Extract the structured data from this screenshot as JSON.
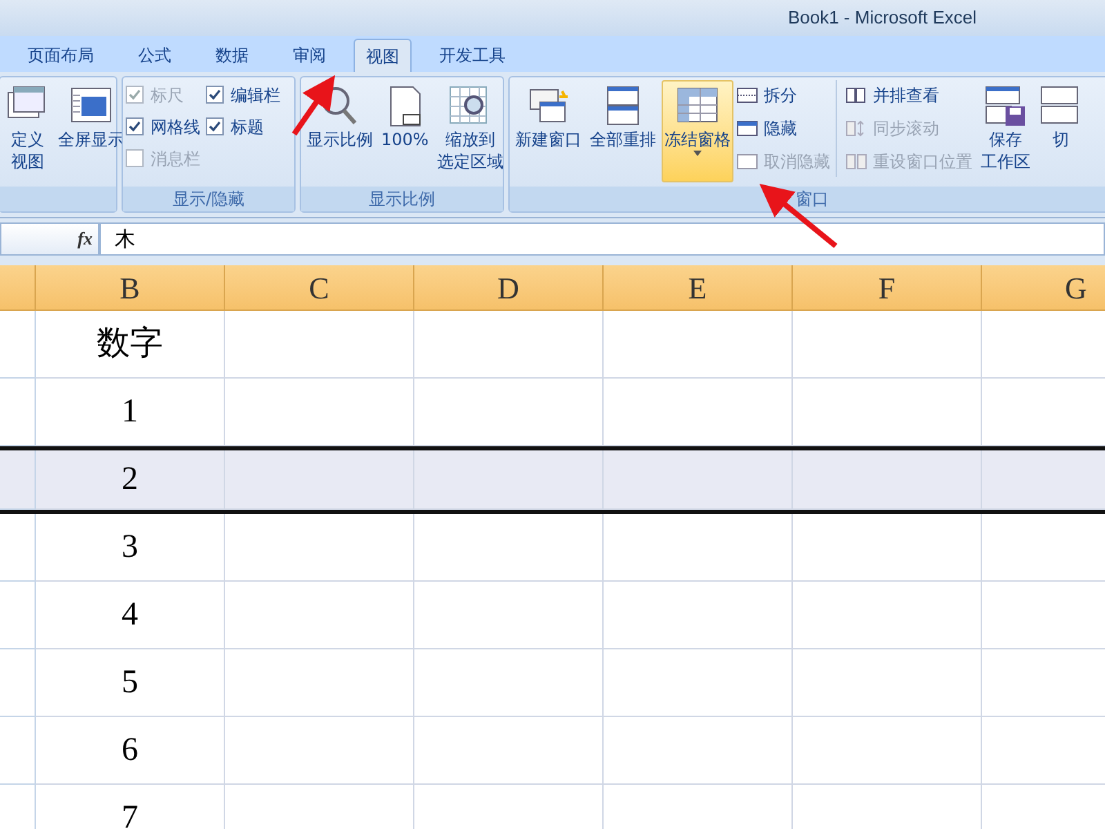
{
  "window": {
    "title": "Book1 - Microsoft Excel"
  },
  "tabs": [
    {
      "label": "页面布局",
      "selected": false
    },
    {
      "label": "公式",
      "selected": false
    },
    {
      "label": "数据",
      "selected": false
    },
    {
      "label": "审阅",
      "selected": false
    },
    {
      "label": "视图",
      "selected": true
    },
    {
      "label": "开发工具",
      "selected": false
    }
  ],
  "ribbon": {
    "groups": [
      {
        "items": [
          {
            "kind": "large",
            "lines": [
              "定义",
              "视图"
            ],
            "highlighted": false
          },
          {
            "kind": "large",
            "label": "全屏显示",
            "highlighted": false
          }
        ]
      },
      {
        "label": "显示/隐藏",
        "items": [
          {
            "kind": "column",
            "items": [
              {
                "kind": "check",
                "label": "标尺",
                "checked": true,
                "disabled": true
              },
              {
                "kind": "check",
                "label": "网格线",
                "checked": true,
                "disabled": false
              },
              {
                "kind": "check",
                "label": "消息栏",
                "checked": false,
                "disabled": true
              }
            ]
          },
          {
            "kind": "column",
            "items": [
              {
                "kind": "check",
                "label": "编辑栏",
                "checked": true,
                "disabled": false
              },
              {
                "kind": "check",
                "label": "标题",
                "checked": true,
                "disabled": false
              }
            ]
          }
        ]
      },
      {
        "label": "显示比例",
        "items": [
          {
            "kind": "large",
            "label": "显示比例",
            "highlighted": false
          },
          {
            "kind": "large",
            "label": "100%",
            "highlighted": false
          },
          {
            "kind": "large",
            "lines": [
              "缩放到",
              "选定区域"
            ],
            "highlighted": false
          }
        ]
      },
      {
        "label": "窗口",
        "items": [
          {
            "kind": "large",
            "label": "新建窗口",
            "highlighted": false
          },
          {
            "kind": "large",
            "label": "全部重排",
            "highlighted": false
          },
          {
            "kind": "large",
            "label": "冻结窗格",
            "highlighted": true,
            "dropdown": true
          },
          {
            "kind": "column",
            "items": [
              {
                "kind": "small",
                "label": "拆分",
                "disabled": false
              },
              {
                "kind": "small",
                "label": "隐藏",
                "disabled": false
              },
              {
                "kind": "small",
                "label": "取消隐藏",
                "disabled": true
              }
            ]
          },
          {
            "kind": "column",
            "items": [
              {
                "kind": "small",
                "label": "并排查看",
                "disabled": false
              },
              {
                "kind": "small",
                "label": "同步滚动",
                "disabled": true
              },
              {
                "kind": "small",
                "label": "重设窗口位置",
                "disabled": true
              }
            ]
          },
          {
            "kind": "large",
            "lines": [
              "保存",
              "工作区"
            ],
            "highlighted": false
          },
          {
            "kind": "large",
            "label": "切",
            "highlighted": false
          }
        ]
      }
    ]
  },
  "formula_bar": {
    "function_label": "fx",
    "value": "木"
  },
  "sheet": {
    "columns": [
      "B",
      "C",
      "D",
      "E",
      "F",
      "G"
    ],
    "rows": [
      {
        "value": "数字",
        "selected": false
      },
      {
        "value": "1",
        "selected": false
      },
      {
        "value": "2",
        "selected": true
      },
      {
        "value": "3",
        "selected": false
      },
      {
        "value": "4",
        "selected": false
      },
      {
        "value": "5",
        "selected": false
      },
      {
        "value": "6",
        "selected": false
      },
      {
        "value": "7",
        "selected": false
      }
    ]
  }
}
